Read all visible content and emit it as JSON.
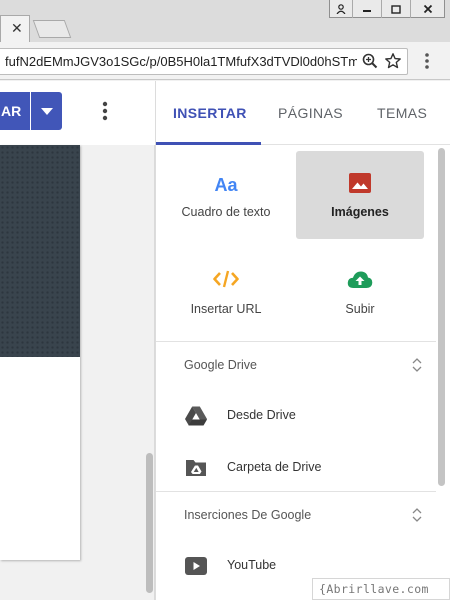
{
  "browser": {
    "tab_close": "✕",
    "url": "fufN2dEMmJGV3o1SGc/p/0B5H0la1TMfufX3dTVDl0d0hSTm",
    "window_buttons": {
      "user": "⛉",
      "minimize": "—",
      "maximize": "▢",
      "close": "✕"
    }
  },
  "editor": {
    "publish_label": "AR",
    "header_color": "#39444d",
    "accent_color": "#4156b8"
  },
  "panel": {
    "tabs": [
      {
        "label": "INSERTAR",
        "active": true
      },
      {
        "label": "PÁGINAS",
        "active": false
      },
      {
        "label": "TEMAS",
        "active": false
      }
    ],
    "tiles": [
      {
        "label": "Cuadro de texto",
        "icon": "text-aa-icon",
        "glyph": "Aa",
        "selected": false
      },
      {
        "label": "Imágenes",
        "icon": "image-icon",
        "selected": true
      },
      {
        "label": "Insertar URL",
        "icon": "embed-code-icon",
        "selected": false
      },
      {
        "label": "Subir",
        "icon": "upload-cloud-icon",
        "selected": false
      }
    ],
    "sections": [
      {
        "title": "Google Drive",
        "items": [
          {
            "label": "Desde Drive",
            "icon": "google-drive-icon"
          },
          {
            "label": "Carpeta de Drive",
            "icon": "drive-folder-icon"
          }
        ]
      },
      {
        "title": "Inserciones De Google",
        "items": [
          {
            "label": "YouTube",
            "icon": "youtube-icon"
          }
        ]
      }
    ],
    "active_color": "#3f51b5"
  },
  "watermark": "{Abrirllave.com"
}
